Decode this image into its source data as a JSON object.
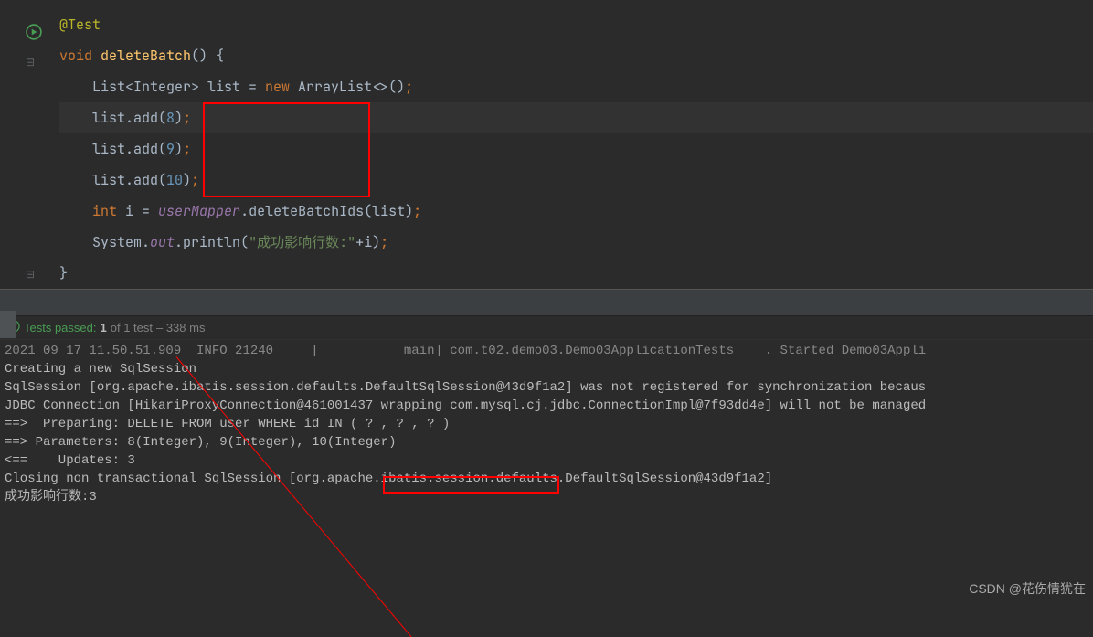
{
  "code": {
    "annotation": "@Test",
    "keyword_void": "void",
    "method_name": "deleteBatch",
    "line3_prefix": "List<Integer> list = ",
    "line3_new": "new",
    "line3_type": " ArrayList<>()",
    "add_calls": [
      {
        "prefix": "list.add(",
        "num": "8",
        "suffix": ")"
      },
      {
        "prefix": "list.add(",
        "num": "9",
        "suffix": ")"
      },
      {
        "prefix": "list.add(",
        "num": "10",
        "suffix": ")"
      }
    ],
    "line7_int": "int",
    "line7_rest": " i = ",
    "line7_var": "userMapper",
    "line7_call": ".deleteBatchIds(list)",
    "line8_system": "System.",
    "line8_out": "out",
    "line8_println": ".println(",
    "line8_str": "\"成功影响行数:\"",
    "line8_end": "+i)",
    "brace_close": "}"
  },
  "test_status": {
    "label_passed": "Tests passed:",
    "count": "1",
    "of": "of 1 test",
    "time": "– 338 ms"
  },
  "console": {
    "line_truncated": "2021 09 17 11.50.51.909  INFO 21240     [           main] com.t02.demo03.Demo03ApplicationTests    . Started Demo03Appli",
    "blank": "",
    "line1": "Creating a new SqlSession",
    "line2": "SqlSession [org.apache.ibatis.session.defaults.DefaultSqlSession@43d9f1a2] was not registered for synchronization becaus",
    "line3": "JDBC Connection [HikariProxyConnection@461001437 wrapping com.mysql.cj.jdbc.ConnectionImpl@7f93dd4e] will not be managed",
    "line4": "==>  Preparing: DELETE FROM user WHERE id IN ( ? , ? , ? )",
    "line5": "==> Parameters: 8(Integer), 9(Integer), 10(Integer)",
    "line6": "<==    Updates: 3",
    "line7": "Closing non transactional SqlSession [org.apache.ibatis.session.defaults.DefaultSqlSession@43d9f1a2]",
    "line8": "成功影响行数:3"
  },
  "watermark": "CSDN @花伤情犹在"
}
